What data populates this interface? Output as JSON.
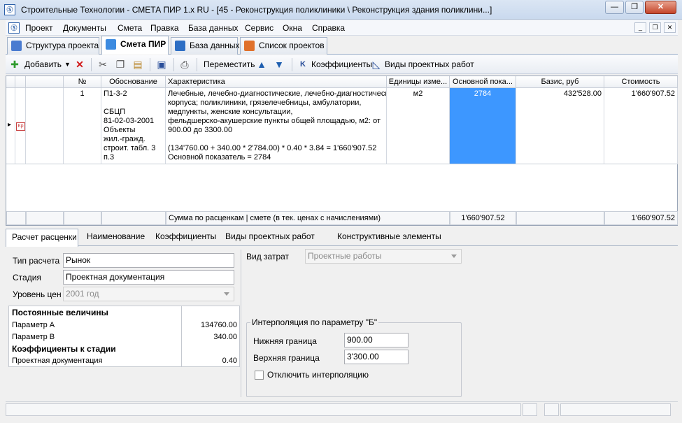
{
  "window": {
    "title": "Строительные Технологии - СМЕТА ПИР 1.x RU - [45 - Реконструкция поликлиники \\ Реконструкция здания поликлини...]",
    "minimize": "—",
    "restore": "❐",
    "close": "✕"
  },
  "menu": {
    "items": [
      "Проект",
      "Документы",
      "Смета",
      "Правка",
      "База данных",
      "Сервис",
      "Окна",
      "Справка"
    ],
    "mdi_buttons": [
      "_",
      "❐",
      "✕"
    ]
  },
  "doc_tabs": [
    {
      "label": "Структура проекта",
      "icon": "tree-icon",
      "color": "#4a7bd0"
    },
    {
      "label": "Смета ПИР",
      "icon": "grid-icon",
      "color": "#3d8be0"
    },
    {
      "label": "База данных",
      "icon": "database-icon",
      "color": "#2d6ec4"
    },
    {
      "label": "Список проектов",
      "icon": "briefcase-icon",
      "color": "#e0702a"
    }
  ],
  "toolbar": {
    "add": "Добавить",
    "move": "Переместить",
    "coefficients": "Коэффициенты",
    "work_types": "Виды проектных работ"
  },
  "grid": {
    "headers": [
      "№",
      "Обоснование",
      "Характеристика",
      "Единицы изме...",
      "Основной пока...",
      "Базис, руб",
      "Стоимость"
    ],
    "row": {
      "marker": "▸",
      "badge": "Кр",
      "num": "1",
      "basis_lines": [
        "П1-3-2",
        "",
        "СБЦП",
        "81-02-03-2001",
        "Объекты",
        "жил.-гражд.",
        "строит. табл. 3",
        "п.3"
      ],
      "characteristic_lines": [
        "Лечебные, лечебно-диагностические,",
        "лечебно-диагностические",
        "корпуса; поликлиники, грязелечебницы, амбулатории,",
        "медпункты, женские консультации,",
        "фельдшерско-акушерские пункты общей площадью, м2: от",
        "900.00 до 3300.00",
        "",
        "(134'760.00 + 340.00 * 2'784.00) * 0.40  * 3.84 = 1'660'907.52",
        "Основной показатель = 2784"
      ],
      "unit": "м2",
      "main_indicator": "2784",
      "basis_rub": "432'528.00",
      "cost": "1'660'907.52"
    },
    "footer": {
      "label": "Сумма по расценкам | смете (в тек. ценах с начислениями)",
      "main_total": "1'660'907.52",
      "cost_total": "1'660'907.52"
    }
  },
  "bottom_tabs": [
    "Расчет расценки",
    "Наименование",
    "Коэффициенты",
    "Виды проектных работ",
    "Конструктивные элементы"
  ],
  "form": {
    "calc_type_label": "Тип расчета",
    "calc_type_value": "Рынок",
    "stage_label": "Стадия",
    "stage_value": "Проектная документация",
    "price_level_label": "Уровень цен",
    "price_level_value": "2001 год",
    "cost_type_label": "Вид затрат",
    "cost_type_value": "Проектные работы"
  },
  "params": {
    "const_header": "Постоянные величины",
    "param_a_label": "Параметр А",
    "param_a_value": "134760.00",
    "param_b_label": "Параметр В",
    "param_b_value": "340.00",
    "coef_header": "Коэффициенты к стадии",
    "stage_doc_label": "Проектная документация",
    "stage_doc_value": "0.40"
  },
  "interpolation": {
    "title": "Интерполяция по параметру \"Б\"",
    "lower_label": "Нижняя граница",
    "lower_value": "900.00",
    "upper_label": "Верхняя граница",
    "upper_value": "3'300.00",
    "disable_label": "Отключить интерполяцию",
    "disabled": false
  }
}
